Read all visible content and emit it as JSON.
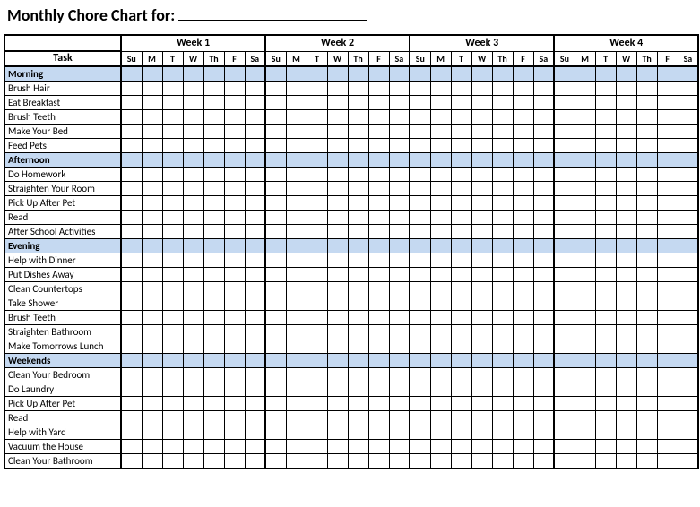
{
  "title": "Monthly Chore Chart for:",
  "task_header": "Task",
  "weeks": [
    "Week 1",
    "Week 2",
    "Week 3",
    "Week 4"
  ],
  "days": [
    "Su",
    "M",
    "T",
    "W",
    "Th",
    "F",
    "Sa"
  ],
  "sections": [
    {
      "name": "Morning",
      "tasks": [
        "Brush Hair",
        "Eat Breakfast",
        "Brush Teeth",
        "Make Your Bed",
        "Feed Pets"
      ]
    },
    {
      "name": "Afternoon",
      "tasks": [
        "Do Homework",
        "Straighten Your Room",
        "Pick Up After Pet",
        "Read",
        "After School Activities"
      ]
    },
    {
      "name": "Evening",
      "tasks": [
        "Help with Dinner",
        "Put Dishes Away",
        "Clean Countertops",
        "Take Shower",
        "Brush Teeth",
        "Straighten Bathroom",
        "Make Tomorrows Lunch"
      ]
    },
    {
      "name": "Weekends",
      "tasks": [
        "Clean Your Bedroom",
        "Do Laundry",
        "Pick Up After Pet",
        "Read",
        "Help with Yard",
        "Vacuum the House",
        "Clean Your Bathroom"
      ]
    }
  ]
}
